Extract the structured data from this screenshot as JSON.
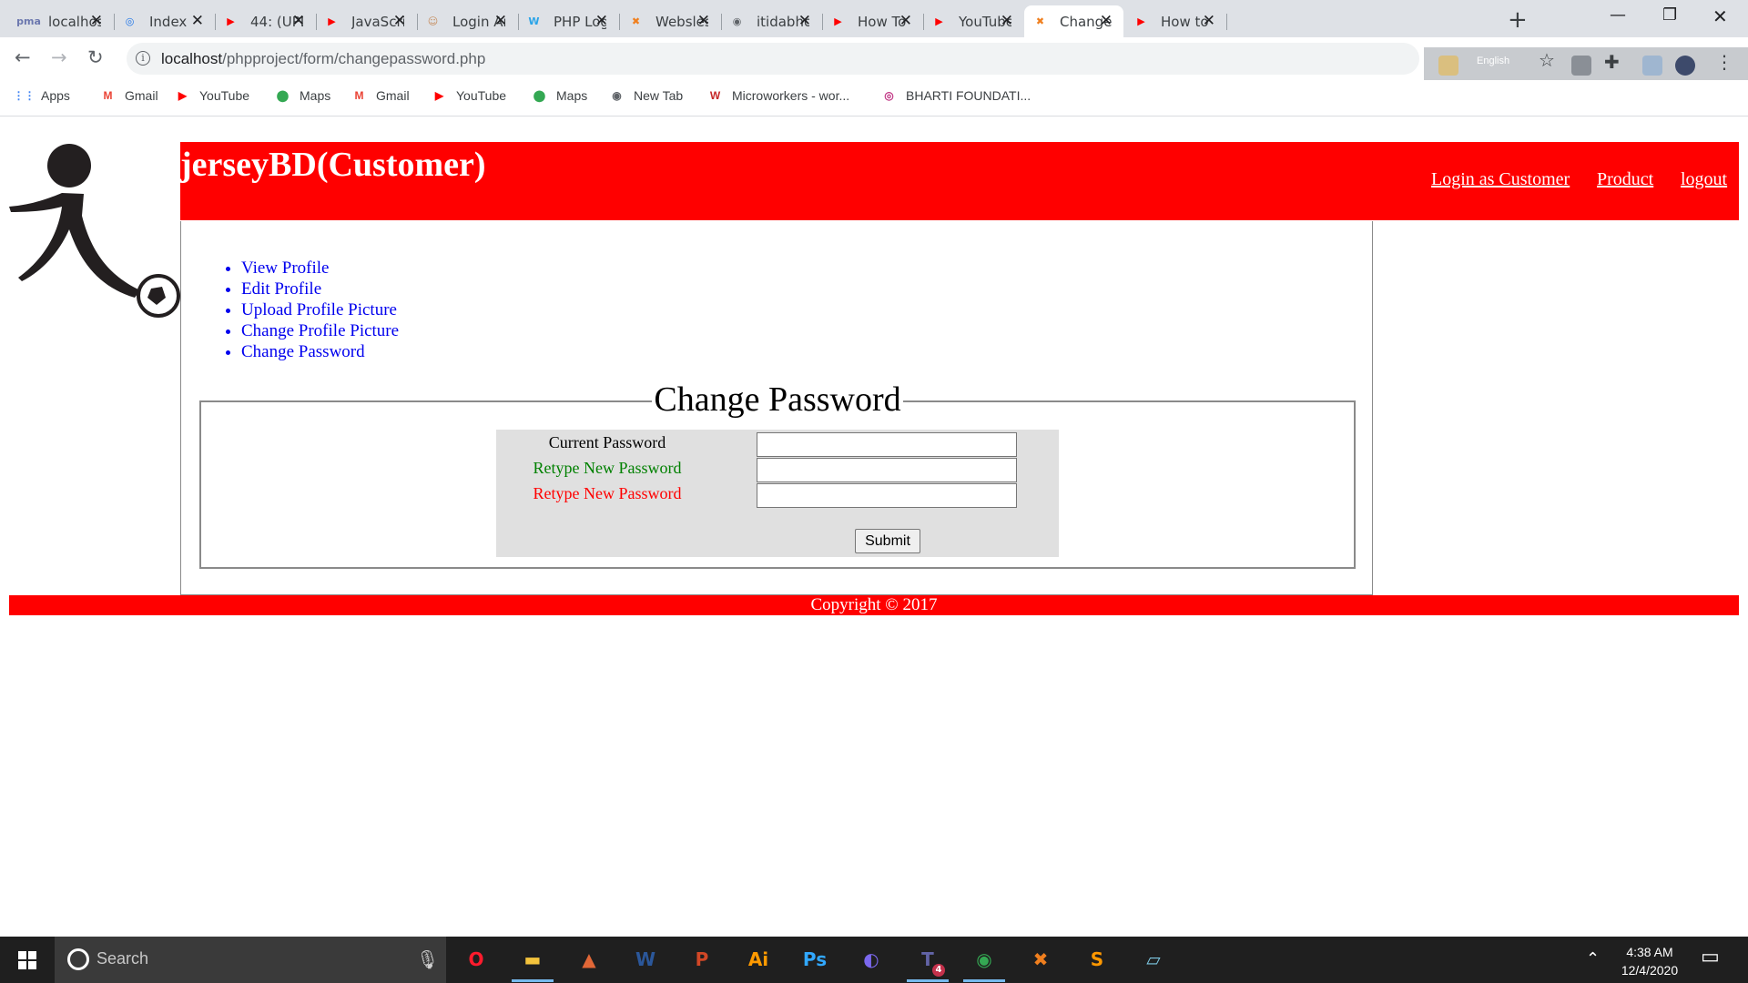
{
  "browser": {
    "tabs": [
      {
        "title": "localhos",
        "favicon": "phpmyadmin-icon",
        "color": "#6c78af",
        "glyph": "pma"
      },
      {
        "title": "Index",
        "favicon": "globe-icon",
        "color": "#1a73e8",
        "glyph": "◎"
      },
      {
        "title": "44: (UPD",
        "favicon": "youtube-icon",
        "color": "#ff0000",
        "glyph": "▶"
      },
      {
        "title": "JavaScri",
        "favicon": "youtube-icon",
        "color": "#ff0000",
        "glyph": "▶"
      },
      {
        "title": "Login Ar",
        "favicon": "person-icon",
        "color": "#c58a5a",
        "glyph": "☺"
      },
      {
        "title": "PHP Log",
        "favicon": "w-icon",
        "color": "#2aa4e8",
        "glyph": "W"
      },
      {
        "title": "Websles",
        "favicon": "xampp-icon",
        "color": "#f07f1e",
        "glyph": "✖"
      },
      {
        "title": "itidabho",
        "favicon": "globe-icon",
        "color": "#5f6368",
        "glyph": "◉"
      },
      {
        "title": "How To",
        "favicon": "youtube-icon",
        "color": "#ff0000",
        "glyph": "▶"
      },
      {
        "title": "YouTube",
        "favicon": "youtube-icon",
        "color": "#ff0000",
        "glyph": "▶"
      },
      {
        "title": "Change",
        "favicon": "xampp-icon",
        "color": "#f07f1e",
        "glyph": "✖",
        "active": true
      },
      {
        "title": "How to",
        "favicon": "youtube-icon",
        "color": "#ff0000",
        "glyph": "▶"
      }
    ],
    "url_host": "localhost",
    "url_path": "/phpproject/form/changepassword.php",
    "language_label": "English",
    "bookmarks": [
      {
        "label": "Apps",
        "icon": "apps-grid-icon",
        "color": "#4285f4",
        "glyph": "⋮⋮"
      },
      {
        "label": "Gmail",
        "icon": "gmail-icon",
        "color": "#ea4335",
        "glyph": "M"
      },
      {
        "label": "YouTube",
        "icon": "youtube-icon",
        "color": "#ff0000",
        "glyph": "▶"
      },
      {
        "label": "Maps",
        "icon": "maps-pin-icon",
        "color": "#34a853",
        "glyph": "⬤"
      },
      {
        "label": "Gmail",
        "icon": "gmail-icon",
        "color": "#ea4335",
        "glyph": "M"
      },
      {
        "label": "YouTube",
        "icon": "youtube-icon",
        "color": "#ff0000",
        "glyph": "▶"
      },
      {
        "label": "Maps",
        "icon": "maps-pin-icon",
        "color": "#34a853",
        "glyph": "⬤"
      },
      {
        "label": "New Tab",
        "icon": "globe-icon",
        "color": "#5f6368",
        "glyph": "◉"
      },
      {
        "label": "Microworkers - wor...",
        "icon": "microworkers-icon",
        "color": "#c62828",
        "glyph": "W"
      },
      {
        "label": "BHARTI FOUNDATI...",
        "icon": "instagram-icon",
        "color": "#c13584",
        "glyph": "◎"
      }
    ]
  },
  "site": {
    "title": "jerseyBD(Customer)",
    "nav": [
      "Login as Customer",
      "Product",
      "logout"
    ],
    "menu": [
      "View Profile",
      "Edit Profile",
      "Upload Profile Picture",
      "Change Profile Picture",
      "Change Password"
    ],
    "form": {
      "legend": "Change Password",
      "fields": [
        {
          "label": "Current Password",
          "color": "#000000",
          "value": ""
        },
        {
          "label": "Retype New Password",
          "color": "#008000",
          "value": ""
        },
        {
          "label": "Retype New Password",
          "color": "#ff0000",
          "value": ""
        }
      ],
      "submit": "Submit"
    },
    "footer": "Copyright © 2017",
    "brand_color": "#ff0000"
  },
  "taskbar": {
    "search_placeholder": "Search",
    "apps": [
      {
        "name": "opera-icon",
        "glyph": "O",
        "color": "#ff1b2d"
      },
      {
        "name": "file-explorer-icon",
        "glyph": "▬",
        "color": "#f3c33c"
      },
      {
        "name": "matlab-icon",
        "glyph": "▲",
        "color": "#e16737"
      },
      {
        "name": "word-icon",
        "glyph": "W",
        "color": "#2b579a"
      },
      {
        "name": "powerpoint-icon",
        "glyph": "P",
        "color": "#d24726"
      },
      {
        "name": "illustrator-icon",
        "glyph": "Ai",
        "color": "#ff9a00"
      },
      {
        "name": "photoshop-icon",
        "glyph": "Ps",
        "color": "#31a8ff"
      },
      {
        "name": "eclipse-icon",
        "glyph": "◐",
        "color": "#7b68ee"
      },
      {
        "name": "teams-icon",
        "glyph": "T",
        "color": "#6264a7"
      },
      {
        "name": "chrome-icon",
        "glyph": "◉",
        "color": "#34a853"
      },
      {
        "name": "xampp-icon",
        "glyph": "✖",
        "color": "#f07f1e"
      },
      {
        "name": "sublime-icon",
        "glyph": "S",
        "color": "#ff9800"
      },
      {
        "name": "notes-icon",
        "glyph": "▱",
        "color": "#7ec8e3"
      }
    ],
    "teams_badge": "4",
    "time": "4:38 AM",
    "date": "12/4/2020"
  }
}
